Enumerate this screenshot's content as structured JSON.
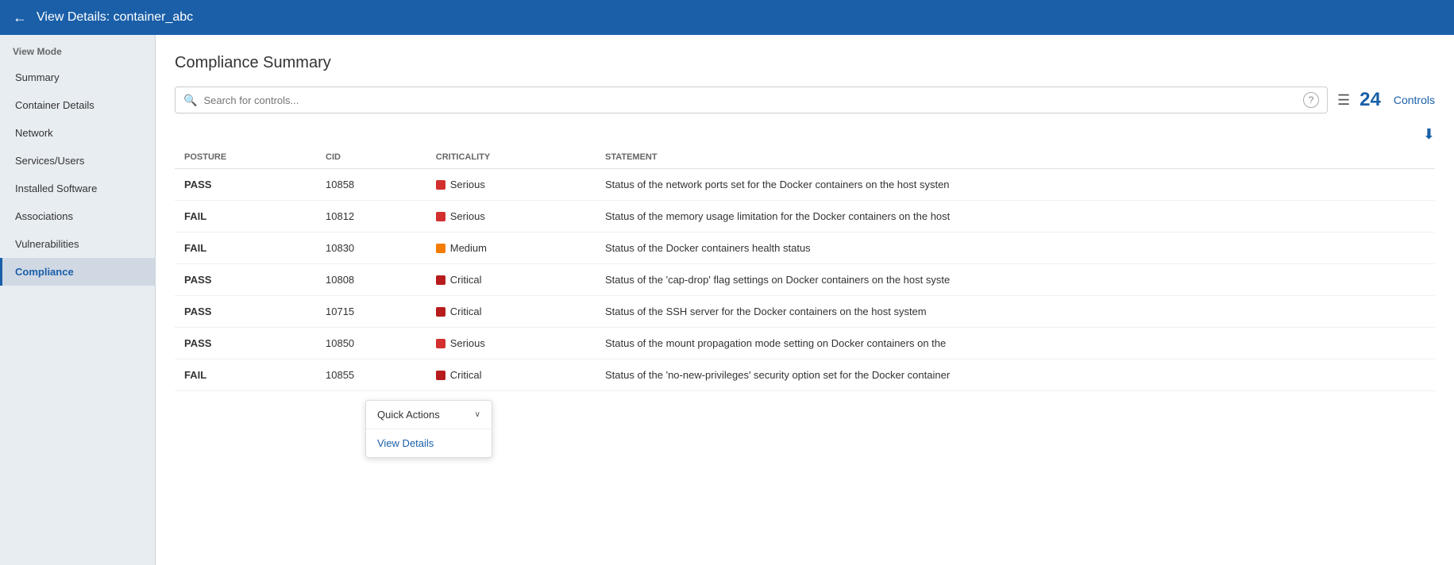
{
  "header": {
    "back_label": "←",
    "title": "View Details:  container_abc"
  },
  "sidebar": {
    "section_label": "View Mode",
    "items": [
      {
        "id": "summary",
        "label": "Summary",
        "active": false
      },
      {
        "id": "container-details",
        "label": "Container Details",
        "active": false
      },
      {
        "id": "network",
        "label": "Network",
        "active": false
      },
      {
        "id": "services-users",
        "label": "Services/Users",
        "active": false
      },
      {
        "id": "installed-software",
        "label": "Installed Software",
        "active": false
      },
      {
        "id": "associations",
        "label": "Associations",
        "active": false
      },
      {
        "id": "vulnerabilities",
        "label": "Vulnerabilities",
        "active": false
      },
      {
        "id": "compliance",
        "label": "Compliance",
        "active": true
      }
    ]
  },
  "content": {
    "page_title": "Compliance Summary",
    "search": {
      "placeholder": "Search for controls...",
      "help_icon": "?"
    },
    "controls_count": "24",
    "controls_label": "Controls",
    "table": {
      "columns": [
        "POSTURE",
        "CID",
        "CRITICALITY",
        "STATEMENT"
      ],
      "rows": [
        {
          "posture": "PASS",
          "cid": "10858",
          "criticality": "Serious",
          "criticality_type": "serious",
          "statement": "Status of the network ports set for the Docker containers on the host systen"
        },
        {
          "posture": "FAIL",
          "cid": "10812",
          "criticality": "Serious",
          "criticality_type": "serious",
          "statement": "Status of the memory usage limitation for the Docker containers on the host"
        },
        {
          "posture": "FAIL",
          "cid": "10830",
          "criticality": "Medium",
          "criticality_type": "medium",
          "statement": "Status of the Docker containers health status"
        },
        {
          "posture": "PASS",
          "cid": "10808",
          "criticality": "Critical",
          "criticality_type": "critical",
          "statement": "Status of the 'cap-drop' flag settings on Docker containers on the host syste"
        },
        {
          "posture": "PASS",
          "cid": "10715",
          "criticality": "Critical",
          "criticality_type": "critical",
          "statement": "Status of the SSH server for the Docker containers on the host system"
        },
        {
          "posture": "PASS",
          "cid": "10850",
          "criticality": "Serious",
          "criticality_type": "serious",
          "statement": "Status of the mount propagation mode setting on Docker containers on the"
        },
        {
          "posture": "FAIL",
          "cid": "10855",
          "criticality": "Critical",
          "criticality_type": "critical",
          "statement": "Status of the 'no-new-privileges' security option set for the Docker container"
        }
      ]
    },
    "quick_actions": {
      "label": "Quick Actions",
      "chevron": "∨",
      "items": [
        {
          "label": "View Details"
        }
      ]
    }
  }
}
